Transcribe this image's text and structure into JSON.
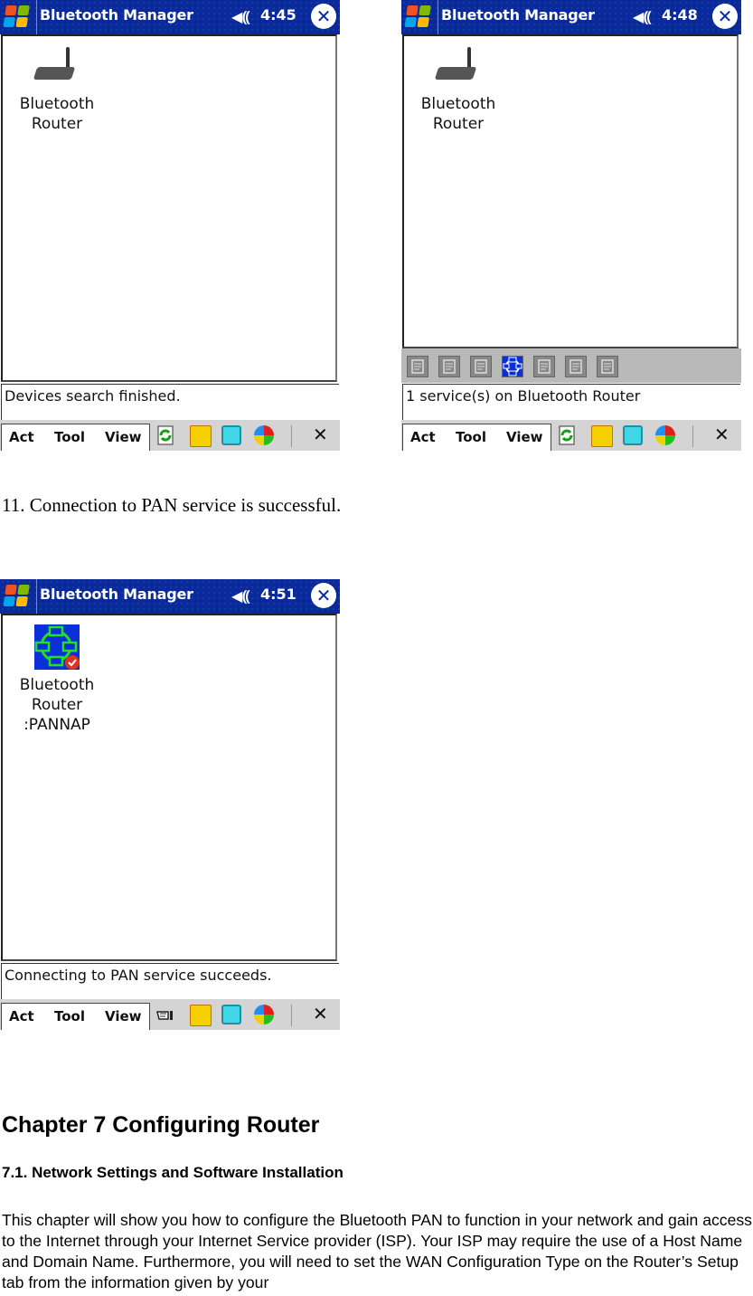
{
  "screens": [
    {
      "title": "Bluetooth Manager",
      "time": "4:45",
      "device_label_lines": [
        "Bluetooth",
        "Router"
      ],
      "device_icon": "router-icon",
      "status": "Devices search finished.",
      "has_service_toolbar": false,
      "menu": [
        "Act",
        "Tool",
        "View"
      ],
      "first_tray_icon": "refresh-icon"
    },
    {
      "title": "Bluetooth Manager",
      "time": "4:48",
      "device_label_lines": [
        "Bluetooth",
        "Router"
      ],
      "device_icon": "router-icon",
      "status": "1 service(s) on Bluetooth Router",
      "has_service_toolbar": true,
      "service_icons": [
        "handshake-icon",
        "transfer-icon",
        "network-tree-icon",
        "pan-network-icon",
        "document-list-icon",
        "copy-icon",
        "serial-port-icon"
      ],
      "selected_service_index": 3,
      "menu": [
        "Act",
        "Tool",
        "View"
      ],
      "first_tray_icon": "refresh-icon"
    },
    {
      "title": "Bluetooth Manager",
      "time": "4:51",
      "device_label_lines": [
        "Bluetooth",
        "Router",
        ":PANNAP"
      ],
      "device_icon": "pan-network-connected-icon",
      "status": "Connecting to PAN service succeeds.",
      "has_service_toolbar": false,
      "menu": [
        "Act",
        "Tool",
        "View"
      ],
      "first_tray_icon": "hand-pointer-icon"
    }
  ],
  "caption": "11. Connection to PAN service is successful.",
  "chapter_title": "Chapter 7 Configuring Router",
  "section_title": "7.1. Network Settings and Software Installation",
  "paragraph": "This chapter will show you how to configure the Bluetooth PAN to function in your network and gain access to the Internet through your Internet Service provider (ISP). Your ISP may require the use of a Host Name and Domain Name.  Furthermore, you will need to set the WAN Configuration Type on the Router’s Setup tab from the information given by your",
  "colors": {
    "titlebar": "#0a2a9a",
    "pan_icon_bg": "#0b2fd8",
    "pan_icon_line": "#22e022"
  }
}
